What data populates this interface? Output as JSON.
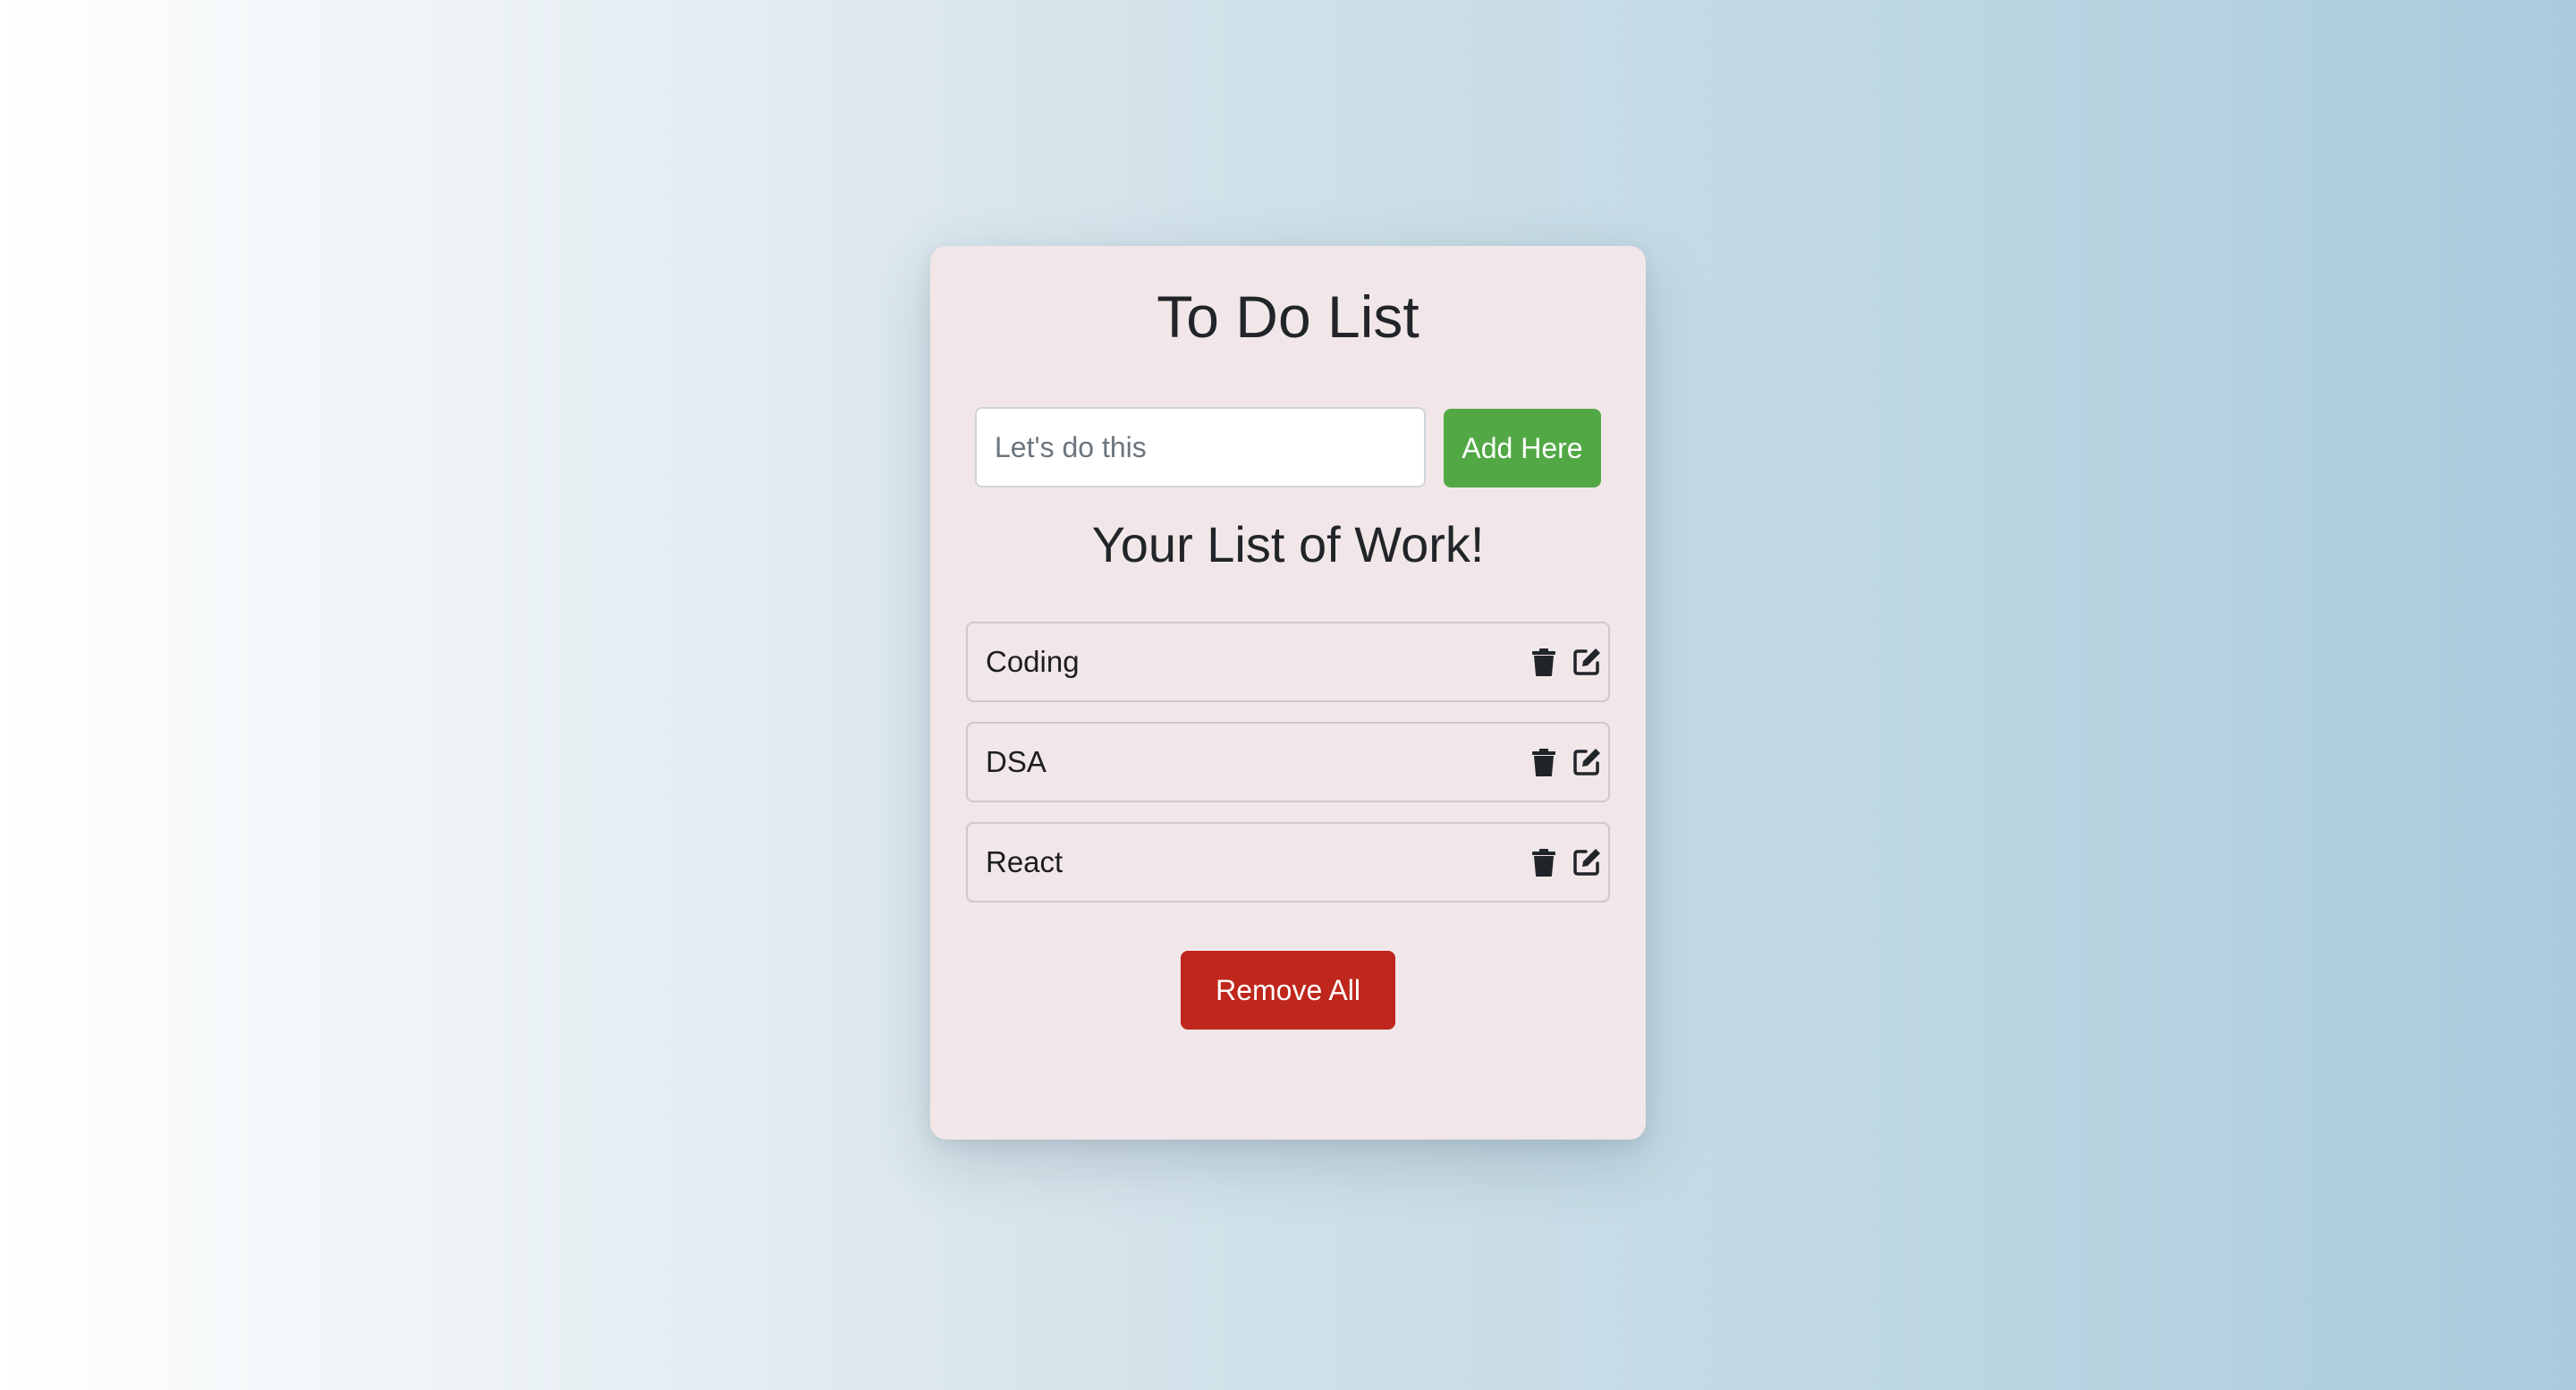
{
  "card": {
    "title": "To Do List",
    "input": {
      "placeholder": "Let's do this",
      "value": ""
    },
    "add_button_label": "Add Here",
    "list_heading": "Your List of Work!",
    "items": [
      {
        "label": "Coding",
        "delete_icon": "trash-icon",
        "edit_icon": "edit-icon"
      },
      {
        "label": "DSA",
        "delete_icon": "trash-icon",
        "edit_icon": "edit-icon"
      },
      {
        "label": "React",
        "delete_icon": "trash-icon",
        "edit_icon": "edit-icon"
      }
    ],
    "remove_all_label": "Remove All"
  },
  "colors": {
    "card_background": "#f2e7e8",
    "add_button": "#52a845",
    "remove_button": "#bf261c",
    "text": "#212529"
  }
}
